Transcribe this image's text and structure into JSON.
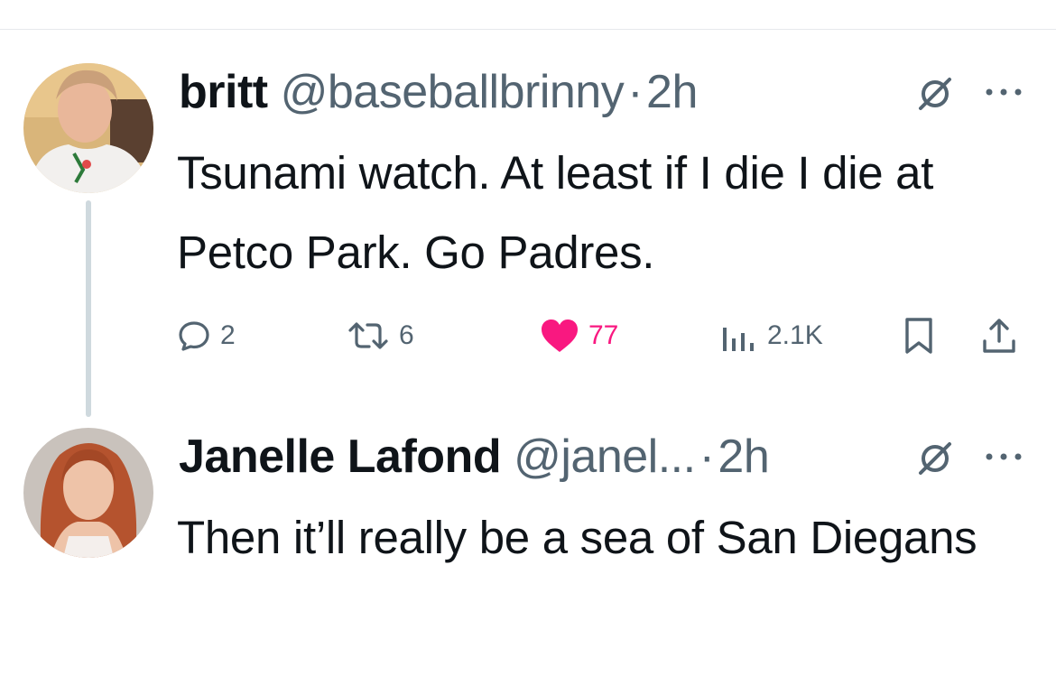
{
  "tweets": [
    {
      "display_name": "britt",
      "handle": "@baseballbrinny",
      "separator": "·",
      "time": "2h",
      "text": "Tsunami watch. At least if I die I die at Petco Park. Go Padres.",
      "stats": {
        "replies": "2",
        "reposts": "6",
        "likes": "77",
        "views": "2.1K"
      }
    },
    {
      "display_name": "Janelle Lafond",
      "handle": "@janel...",
      "separator": "·",
      "time": "2h",
      "text": "Then it’ll really be a sea of San Diegans"
    }
  ],
  "icons": {
    "reply": "speech-bubble-icon",
    "repost": "repost-arrows-icon",
    "like": "heart-icon",
    "views": "bar-chart-icon",
    "bookmark": "bookmark-icon",
    "share": "share-upload-icon",
    "grok": "grok-slash-circle-icon",
    "more": "more-dots-icon"
  },
  "colors": {
    "text_primary": "#0f1419",
    "text_secondary": "#536471",
    "like_active": "#f91880",
    "thread_line": "#cfd9de"
  }
}
